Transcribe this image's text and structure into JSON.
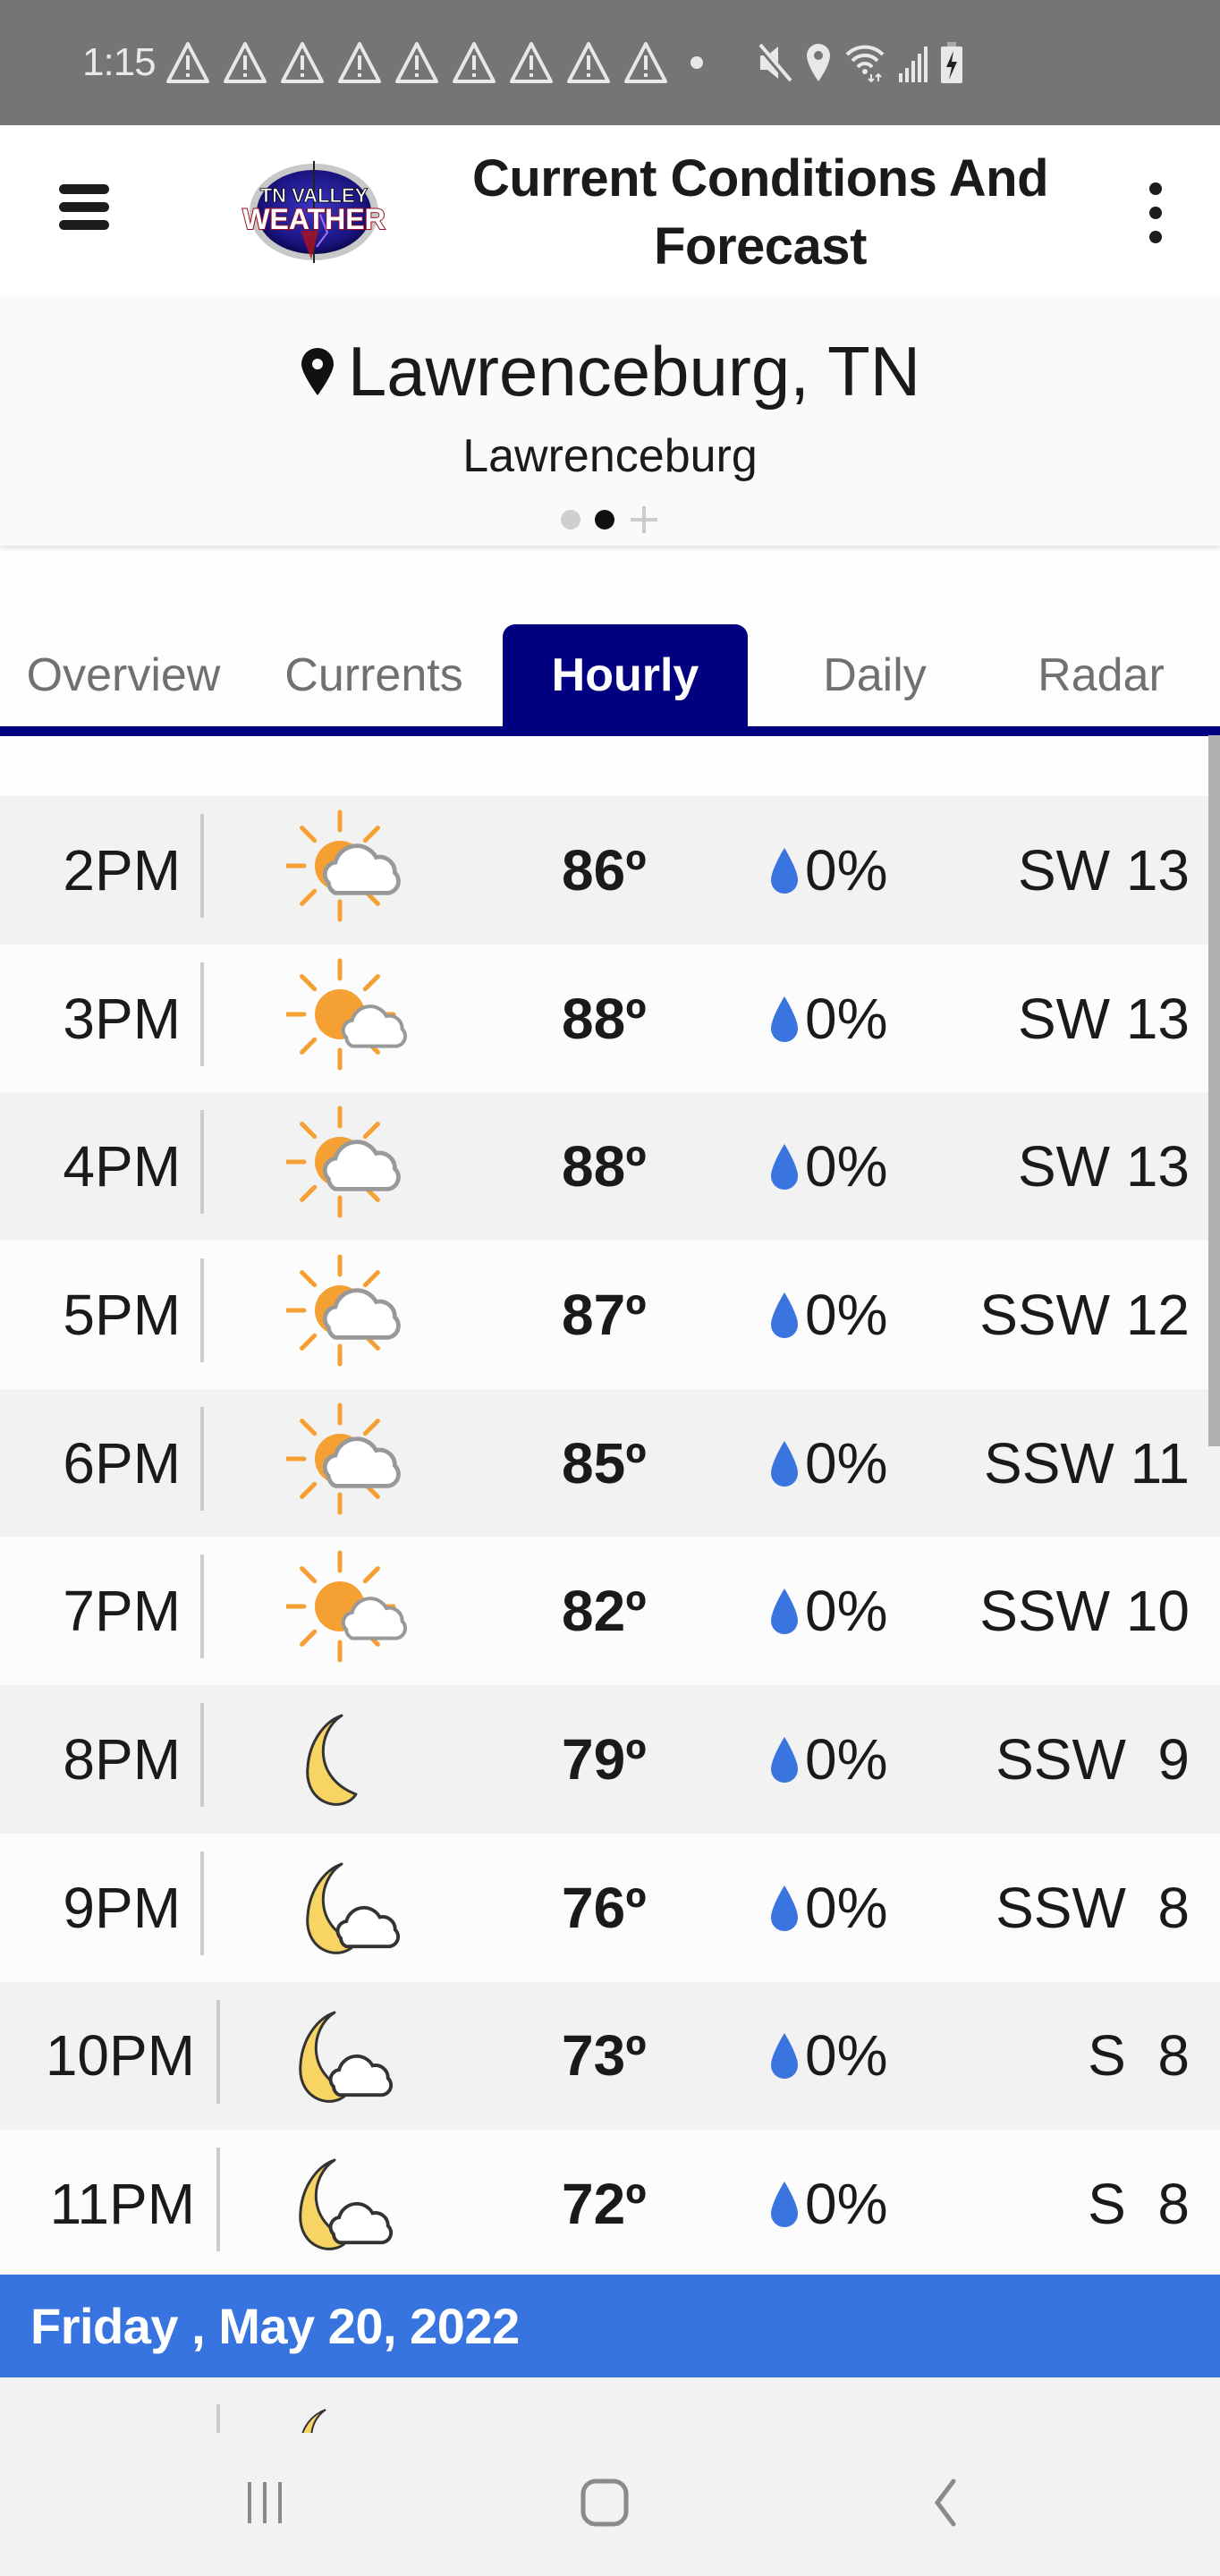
{
  "status_bar": {
    "time": "1:15",
    "notification_icons": [
      "warning-icon",
      "warning-icon",
      "warning-icon",
      "warning-icon",
      "warning-icon",
      "warning-icon",
      "warning-icon",
      "warning-icon",
      "warning-icon"
    ],
    "system_icons": [
      "mute-icon",
      "location-icon",
      "wifi-icon",
      "signal-icon",
      "battery-charging-icon"
    ]
  },
  "header": {
    "logo_line1": "TN VALLEY",
    "logo_line2": "WEATHER",
    "title_line1": "Current Conditions And",
    "title_line2": "Forecast"
  },
  "location": {
    "name": "Lawrenceburg, TN",
    "subtitle": "Lawrenceburg",
    "pages": 2,
    "active_page": 2
  },
  "tabs": [
    {
      "label": "Overview",
      "active": false
    },
    {
      "label": "Currents",
      "active": false
    },
    {
      "label": "Hourly",
      "active": true
    },
    {
      "label": "Daily",
      "active": false
    },
    {
      "label": "Radar",
      "active": false
    }
  ],
  "colors": {
    "accent_navy": "#000080",
    "day_header_blue": "#3874e0",
    "precip_drop": "#3a74de",
    "sun_orange": "#f5a033",
    "moon_yellow": "#f8d465"
  },
  "hourly": [
    {
      "hour": "2PM",
      "icon": "mostly-cloudy-day",
      "temp": "86º",
      "precip": "0%",
      "wind": "SW 13"
    },
    {
      "hour": "3PM",
      "icon": "partly-cloudy-day",
      "temp": "88º",
      "precip": "0%",
      "wind": "SW 13"
    },
    {
      "hour": "4PM",
      "icon": "mostly-cloudy-day",
      "temp": "88º",
      "precip": "0%",
      "wind": "SW 13"
    },
    {
      "hour": "5PM",
      "icon": "mostly-cloudy-day",
      "temp": "87º",
      "precip": "0%",
      "wind": "SSW 12"
    },
    {
      "hour": "6PM",
      "icon": "mostly-cloudy-day",
      "temp": "85º",
      "precip": "0%",
      "wind": "SSW 11"
    },
    {
      "hour": "7PM",
      "icon": "partly-cloudy-day",
      "temp": "82º",
      "precip": "0%",
      "wind": "SSW 10"
    },
    {
      "hour": "8PM",
      "icon": "clear-night",
      "temp": "79º",
      "precip": "0%",
      "wind": "SSW  9"
    },
    {
      "hour": "9PM",
      "icon": "partly-cloudy-night",
      "temp": "76º",
      "precip": "0%",
      "wind": "SSW  8"
    },
    {
      "hour": "10PM",
      "icon": "partly-cloudy-night",
      "temp": "73º",
      "precip": "0%",
      "wind": "S  8"
    },
    {
      "hour": "11PM",
      "icon": "partly-cloudy-night",
      "temp": "72º",
      "precip": "0%",
      "wind": "S  8"
    }
  ],
  "day_header": "Friday , May 20, 2022",
  "nav_bar": {
    "recents": "recents-icon",
    "home": "home-icon",
    "back": "back-icon"
  }
}
